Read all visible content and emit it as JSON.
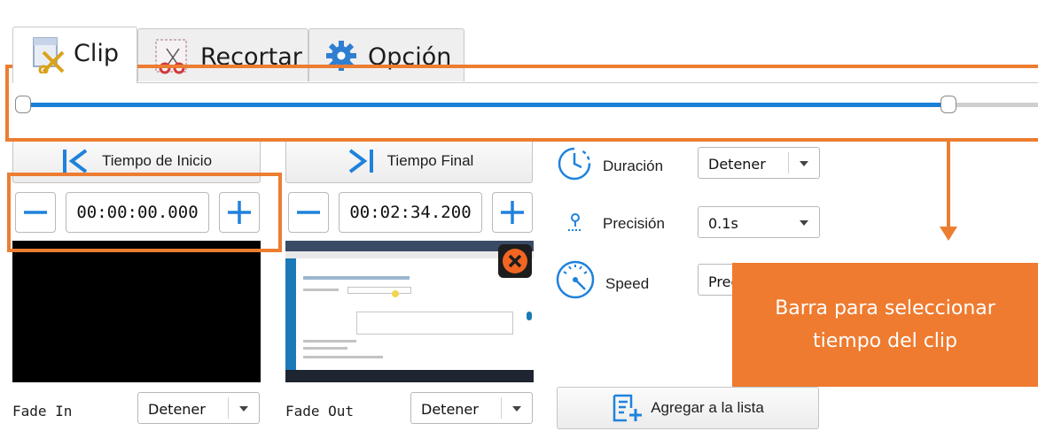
{
  "tabs": [
    {
      "label": "Clip",
      "icon": "clip-scissors-icon"
    },
    {
      "label": "Recortar",
      "icon": "crop-scissors-icon"
    },
    {
      "label": "Opción",
      "icon": "gear-icon"
    }
  ],
  "slider": {
    "start_fraction": 0.0,
    "end_fraction": 0.93
  },
  "start": {
    "button_label": "Tiempo de Inicio",
    "time": "00:00:00.000"
  },
  "end": {
    "button_label": "Tiempo Final",
    "time": "00:02:34.200"
  },
  "options": {
    "duration": {
      "label": "Duración",
      "value": "Detener"
    },
    "precision": {
      "label": "Precisión",
      "value": "0.1s"
    },
    "speed": {
      "label": "Speed",
      "value": "Pred"
    }
  },
  "fade_in": {
    "label": "Fade In",
    "value": "Detener"
  },
  "fade_out": {
    "label": "Fade Out",
    "value": "Detener"
  },
  "add_to_list": {
    "label": "Agregar a la lista"
  },
  "annotation": {
    "line1": "Barra para seleccionar",
    "line2": "tiempo del clip"
  },
  "colors": {
    "accent_blue": "#1a7fd6",
    "annotation_orange": "#ec7d31",
    "close_orange": "#f26522"
  }
}
